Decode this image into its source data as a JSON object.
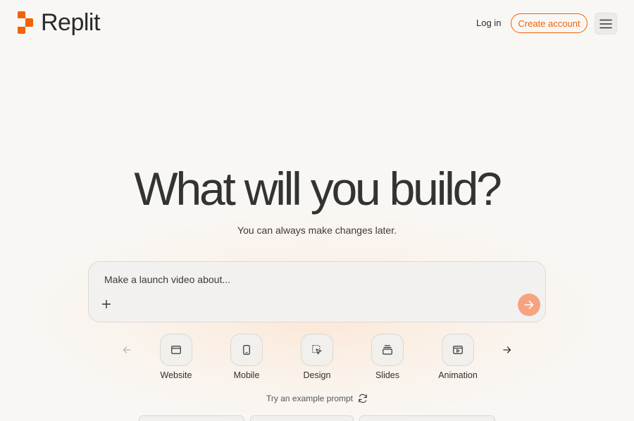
{
  "brand": {
    "name": "Replit",
    "accent": "#f26207"
  },
  "header": {
    "login_label": "Log in",
    "create_account_label": "Create account",
    "menu_icon": "hamburger-menu-icon"
  },
  "hero": {
    "title": "What will you build?",
    "subtitle": "You can always make changes later."
  },
  "prompt": {
    "placeholder": "Make a launch video about...",
    "value": "",
    "attach_icon": "plus-icon",
    "send_icon": "arrow-right-icon"
  },
  "categories": [
    {
      "label": "Website",
      "icon": "browser-window-icon"
    },
    {
      "label": "Mobile",
      "icon": "mobile-phone-icon"
    },
    {
      "label": "Design",
      "icon": "design-cursor-icon"
    },
    {
      "label": "Slides",
      "icon": "slides-stack-icon"
    },
    {
      "label": "Animation",
      "icon": "animation-play-icon"
    }
  ],
  "example_prompt": {
    "label": "Try an example prompt",
    "icon": "refresh-icon"
  }
}
